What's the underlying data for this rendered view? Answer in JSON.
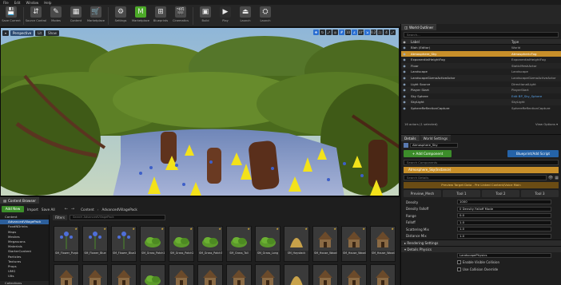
{
  "menubar": [
    "File",
    "Edit",
    "Window",
    "Help"
  ],
  "toolbar": [
    {
      "label": "Save Current",
      "icon": "save-icon",
      "glyph": "💾"
    },
    {
      "label": "Source Control",
      "icon": "source-control-icon",
      "glyph": "⇵"
    },
    {
      "label": "Modes",
      "icon": "modes-icon",
      "glyph": "✎"
    },
    {
      "label": "Content",
      "icon": "content-icon",
      "glyph": "▦"
    },
    {
      "label": "Marketplace",
      "icon": "marketplace-icon",
      "glyph": "🛒"
    },
    {
      "label": "Settings",
      "icon": "settings-icon",
      "glyph": "⚙"
    },
    {
      "label": "Marketplace",
      "icon": "marketplace-green-icon",
      "glyph": "M"
    },
    {
      "label": "Blueprints",
      "icon": "blueprints-icon",
      "glyph": "⊞"
    },
    {
      "label": "Cinematics",
      "icon": "cinematics-icon",
      "glyph": "🎬"
    },
    {
      "label": "Build",
      "icon": "build-icon",
      "glyph": "▣"
    },
    {
      "label": "Play",
      "icon": "play-icon",
      "glyph": "▶"
    },
    {
      "label": "Launch",
      "icon": "launch-icon",
      "glyph": "⏏"
    },
    {
      "label": "Launch",
      "icon": "launch2-icon",
      "glyph": "⛭"
    }
  ],
  "viewport": {
    "tab": "Viewport 1",
    "mode_label": "Perspective",
    "lit_label": "Lit",
    "show_label": "Show",
    "grid_value": "10",
    "angle_value": "10°",
    "scale_value": "0.25",
    "camera_speed": "4"
  },
  "outliner": {
    "tab": "World Outliner",
    "search_placeholder": "Search...",
    "col_label": "Label",
    "col_type": "Type",
    "rows": [
      {
        "label": "Blah (Editor)",
        "type": "World",
        "sel": false,
        "link": false
      },
      {
        "label": "Atmosphere_Sky",
        "type": "AtmosphericFog",
        "sel": true,
        "link": false
      },
      {
        "label": "ExponentialHeightFog",
        "type": "ExponentialHeightFog",
        "sel": false,
        "link": false
      },
      {
        "label": "Floor",
        "type": "StaticMeshActor",
        "sel": false,
        "link": false
      },
      {
        "label": "Landscape",
        "type": "Landscape",
        "sel": false,
        "link": false
      },
      {
        "label": "LandscapeGizmoActiveActor",
        "type": "LandscapeGizmoActiveActor",
        "sel": false,
        "link": false
      },
      {
        "label": "Light Source",
        "type": "DirectionalLight",
        "sel": false,
        "link": false
      },
      {
        "label": "Player Start",
        "type": "PlayerStart",
        "sel": false,
        "link": false
      },
      {
        "label": "Sky Sphere",
        "type": "Edit BP_Sky_Sphere",
        "sel": false,
        "link": true
      },
      {
        "label": "SkyLight",
        "type": "SkyLight",
        "sel": false,
        "link": false
      },
      {
        "label": "SphereReflectionCapture",
        "type": "SphereReflectionCapture",
        "sel": false,
        "link": false
      }
    ],
    "count": "16 actors (1 selected)",
    "view_options": "View Options ▾"
  },
  "details": {
    "tab_details": "Details",
    "tab_world": "World Settings",
    "name_value": "Atmosphere_Sky",
    "add_component": "+ Add Component",
    "blueprint_script": "Blueprint/Add Script",
    "search_placeholder": "Search Components",
    "component_selected": "Atmosphere_Sky(Instance)",
    "search_details": "Search Details",
    "warning": "Preview Target Data - Pre Linked Content/Voice Main",
    "subtabs": [
      "Preview_Mesh",
      "Tool 1",
      "Tool 2",
      "Tool 3"
    ],
    "props": [
      {
        "name": "Density",
        "value": "1000"
      },
      {
        "name": "Density Falloff",
        "value": "0 Density Falloff Mode"
      },
      {
        "name": "Range",
        "value": "0.0"
      },
      {
        "name": "Falloff",
        "value": "1.0"
      },
      {
        "name": "Scattering Mix",
        "value": "1.0"
      },
      {
        "name": "Distance Mix",
        "value": "1.0"
      }
    ],
    "section_rendering": "▸ Rendering Settings",
    "section_physics": "▾ Details Physics",
    "physics_value": "LandscapePhysics",
    "chk1": "Enable Visible Collision",
    "chk2": "Use Collision Override"
  },
  "content_browser": {
    "tab": "Content Browser",
    "add_new": "Add New",
    "import": "Import",
    "save_all": "Save All",
    "path": [
      "Content",
      "AdvancedVillagePack"
    ],
    "filters": "Filters",
    "search_placeholder": "Search AdvancedVillagePack",
    "tree": [
      "Content",
      "AdvancedVillagePack",
      "FoodNDrinks",
      "Maps",
      "Meshes",
      "Megascans",
      "Materials",
      "StarterContent",
      "Particles",
      "Textures",
      "Props",
      "UMG",
      "Ults"
    ],
    "tree_footer": "Collections",
    "assets_row1": [
      {
        "name": "SM_Flower_Purple",
        "kind": "flower"
      },
      {
        "name": "SM_Flower_Blue",
        "kind": "flower"
      },
      {
        "name": "SM_Flower_Blue2",
        "kind": "flower"
      },
      {
        "name": "SM_Grass_Patch1",
        "kind": "grass"
      },
      {
        "name": "SM_Grass_Patch2",
        "kind": "grass"
      },
      {
        "name": "SM_Grass_Patch3",
        "kind": "grass"
      },
      {
        "name": "SM_Grass_Tall",
        "kind": "grass"
      },
      {
        "name": "SM_Grass_Long",
        "kind": "grass"
      },
      {
        "name": "SM_Haystack",
        "kind": "hay"
      },
      {
        "name": "SM_House_Wood1",
        "kind": "house"
      },
      {
        "name": "SM_House_Wood2",
        "kind": "house"
      },
      {
        "name": "SM_House_Wood3",
        "kind": "house"
      }
    ],
    "assets_row2_count": 12
  }
}
